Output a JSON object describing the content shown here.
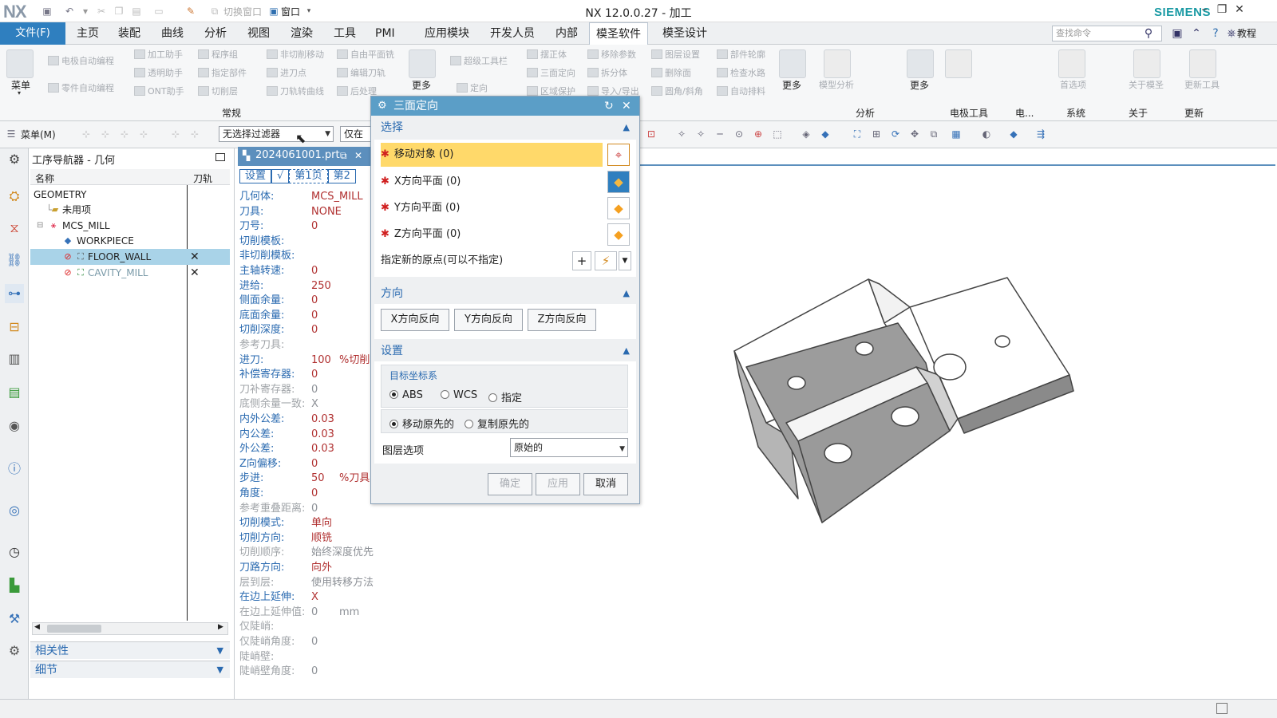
{
  "titlebar": {
    "logo": "NX",
    "title": "NX 12.0.0.27 - 加工",
    "brand": "SIEMENS",
    "switch_window": "切换窗口",
    "window_menu": "窗口"
  },
  "menubar": {
    "file": "文件(F)",
    "items": [
      "主页",
      "装配",
      "曲线",
      "分析",
      "视图",
      "渲染",
      "工具",
      "PMI",
      "应用模块",
      "开发人员",
      "内部",
      "模圣软件",
      "模圣设计"
    ],
    "active": "模圣软件",
    "search_placeholder": "查找命令",
    "tutorial": "教程"
  },
  "ribbon": {
    "menu_label": "菜单",
    "group_common": "常规",
    "col1": [
      "电极自动编程",
      "零件自动编程"
    ],
    "col2": [
      "加工助手",
      "透明助手",
      "ONT助手"
    ],
    "col3": [
      "程序组",
      "指定部件",
      "切削层"
    ],
    "col4": [
      "非切削移动",
      "进刀点",
      "刀轨转曲线"
    ],
    "col5": [
      "自由平面铣",
      "编辑刀轨",
      "后处理"
    ],
    "more1": "更多",
    "col6": [
      "超级工具栏",
      "定向"
    ],
    "col7": [
      "摆正体",
      "三面定向",
      "区域保护"
    ],
    "col8": [
      "移除参数",
      "拆分体",
      "导入/导出"
    ],
    "col9": [
      "图层设置",
      "删除面",
      "圆角/斜角"
    ],
    "col10": [
      "部件轮廓",
      "检查水路",
      "自动排料"
    ],
    "more2": "更多",
    "model_analysis": "模型分析",
    "more3": "更多",
    "group_analysis": "分析",
    "group_electrode_tools": "电极工具",
    "group_electrode_short": "电...",
    "preferences": "首选项",
    "about_mosheng": "关于模圣",
    "update_tools": "更新工具",
    "group_system": "系统",
    "group_about": "关于",
    "group_update": "更新"
  },
  "toolbar2": {
    "menu": "菜单(M)",
    "filter": "无选择过滤器",
    "scope": "仅在工"
  },
  "navigator": {
    "title": "工序导航器 - 几何",
    "col_name": "名称",
    "col_path": "刀轨",
    "rows": [
      {
        "label": "GEOMETRY"
      },
      {
        "label": "未用项"
      },
      {
        "label": "MCS_MILL"
      },
      {
        "label": "WORKPIECE"
      },
      {
        "label": "FLOOR_WALL",
        "path": "✕"
      },
      {
        "label": "CAVITY_MILL",
        "path": "✕"
      }
    ],
    "sections": [
      "相关性",
      "细节"
    ]
  },
  "doc_tab": {
    "label": "2024061001.prt"
  },
  "op_panel": {
    "tabs": [
      "设置",
      "√",
      "第1页",
      "第2"
    ],
    "rows": [
      {
        "label": "几何体:",
        "value": "MCS_MILL"
      },
      {
        "label": "刀具:",
        "value": "NONE"
      },
      {
        "label": "刀号:",
        "value": "0"
      },
      {
        "label": "切削模板:",
        "value": ""
      },
      {
        "label": "非切削模板:",
        "value": ""
      },
      {
        "label": "主轴转速:",
        "value": "0"
      },
      {
        "label": "进给:",
        "value": "250"
      },
      {
        "label": "侧面余量:",
        "value": "0"
      },
      {
        "label": "底面余量:",
        "value": "0"
      },
      {
        "label": "切削深度:",
        "value": "0"
      },
      {
        "label": "参考刀具:",
        "value": ""
      },
      {
        "label": "进刀:",
        "value": "100",
        "unit": "%切削"
      },
      {
        "label": "补偿寄存器:",
        "value": "0"
      },
      {
        "label": "刀补寄存器:",
        "value": "0"
      },
      {
        "label": "底侧余量一致:",
        "value": "X"
      },
      {
        "label": "内外公差:",
        "value": "0.03"
      },
      {
        "label": "内公差:",
        "value": "0.03"
      },
      {
        "label": "外公差:",
        "value": "0.03"
      },
      {
        "label": "Z向偏移:",
        "value": "0"
      },
      {
        "label": "步进:",
        "value": "50",
        "unit": "%刀具"
      },
      {
        "label": "角度:",
        "value": "0"
      },
      {
        "label": "参考重叠距离:",
        "value": "0"
      },
      {
        "label": "切削模式:",
        "value": "单向"
      },
      {
        "label": "切削方向:",
        "value": "顺铣"
      },
      {
        "label": "切削顺序:",
        "value": "始终深度优先"
      },
      {
        "label": "刀路方向:",
        "value": "向外"
      },
      {
        "label": "层到层:",
        "value": "使用转移方法"
      },
      {
        "label": "在边上延伸:",
        "value": "X"
      },
      {
        "label": "在边上延伸值:",
        "value": "0",
        "unit": "mm"
      },
      {
        "label": "仅陡峭:",
        "value": ""
      },
      {
        "label": "仅陡峭角度:",
        "value": "0"
      },
      {
        "label": "陡峭壁:",
        "value": ""
      },
      {
        "label": "陡峭壁角度:",
        "value": "0"
      }
    ]
  },
  "dialog": {
    "title": "三面定向",
    "sec_select": "选择",
    "move_object": "移动对象 (0)",
    "x_plane": "X方向平面 (0)",
    "y_plane": "Y方向平面 (0)",
    "z_plane": "Z方向平面 (0)",
    "origin_label": "指定新的原点(可以不指定)",
    "sec_direction": "方向",
    "x_reverse": "X方向反向",
    "y_reverse": "Y方向反向",
    "z_reverse": "Z方向反向",
    "sec_settings": "设置",
    "target_cs_label": "目标坐标系",
    "cs_options": [
      "ABS",
      "WCS",
      "指定"
    ],
    "cs_selected": "ABS",
    "copy_options": [
      "移动原先的",
      "复制原先的"
    ],
    "copy_selected": "移动原先的",
    "layer_label": "图层选项",
    "layer_value": "原始的",
    "ok": "确定",
    "apply": "应用",
    "cancel": "取消"
  },
  "colors": {
    "accent": "#2f7fbf",
    "dialog_title": "#5b9ec7",
    "highlight": "#ffd96a",
    "selected_row": "#a9d3e8"
  }
}
